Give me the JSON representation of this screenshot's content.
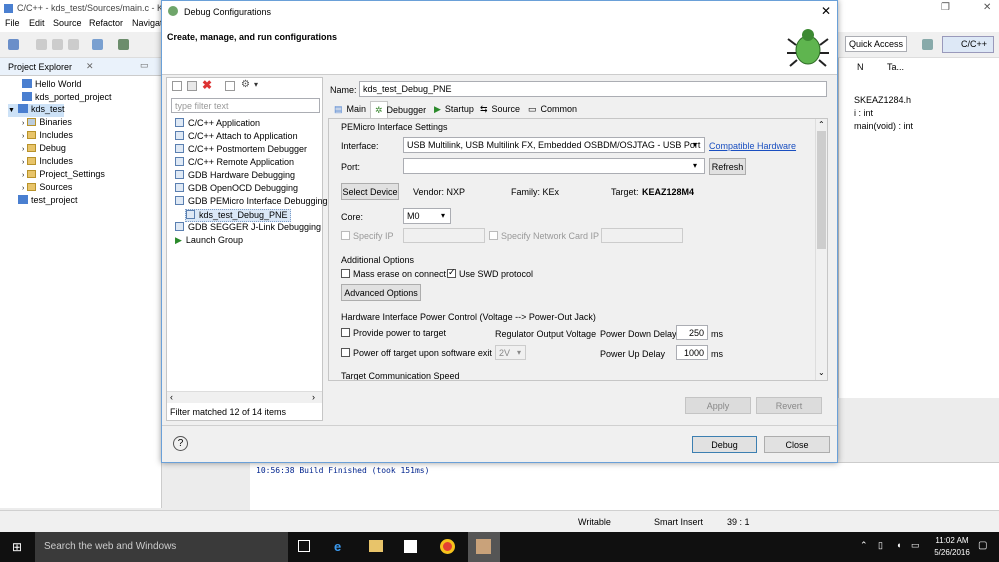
{
  "eclipse": {
    "window_title": "C/C++ - kds_test/Sources/main.c - Ki",
    "menu": [
      "File",
      "Edit",
      "Source",
      "Refactor",
      "Navigat"
    ],
    "quick_access": "Quick Access",
    "perspective": "C/C++"
  },
  "project_explorer": {
    "title": "Project Explorer",
    "items": [
      {
        "label": "Hello World"
      },
      {
        "label": "kds_ported_project"
      },
      {
        "label": "kds_test"
      },
      {
        "label": "Binaries"
      },
      {
        "label": "Includes"
      },
      {
        "label": "Debug"
      },
      {
        "label": "Includes"
      },
      {
        "label": "Project_Settings"
      },
      {
        "label": "Sources"
      },
      {
        "label": "test_project"
      }
    ]
  },
  "outline": {
    "tab1": "N",
    "tab2": "Ta...",
    "items": [
      "SKEAZ1284.h",
      "i : int",
      "main(void) : int"
    ]
  },
  "console": {
    "line": "10:56:38 Build Finished (took 151ms)"
  },
  "status": {
    "writable": "Writable",
    "insert": "Smart Insert",
    "position": "39 : 1"
  },
  "taskbar": {
    "search": "Search the web and Windows",
    "time": "11:02 AM",
    "date": "5/26/2016"
  },
  "dialog": {
    "title": "Debug Configurations",
    "banner": "Create, manage, and run configurations",
    "filter_placeholder": "type filter text",
    "configs": [
      "C/C++ Application",
      "C/C++ Attach to Application",
      "C/C++ Postmortem Debugger",
      "C/C++ Remote Application",
      "GDB Hardware Debugging",
      "GDB OpenOCD Debugging",
      "GDB PEMicro Interface Debugging",
      "kds_test_Debug_PNE",
      "GDB SEGGER J-Link Debugging",
      "Launch Group"
    ],
    "filter_status": "Filter matched 12 of 14 items",
    "name_label": "Name:",
    "name_value": "kds_test_Debug_PNE",
    "tabs": [
      "Main",
      "Debugger",
      "Startup",
      "Source",
      "Common"
    ],
    "pemicro_section": "PEMicro Interface Settings",
    "interface_label": "Interface:",
    "interface_value": "USB Multilink, USB Multilink FX, Embedded OSBDM/OSJTAG - USB Port",
    "compat_link": "Compatible Hardware",
    "port_label": "Port:",
    "port_value": "",
    "refresh": "Refresh",
    "select_device": "Select Device",
    "vendor": "Vendor:  NXP",
    "family": "Family:  KEx",
    "target_label": "Target:",
    "target_value": "KEAZ128M4",
    "core_label": "Core:",
    "core_value": "M0",
    "specify_ip": "Specify IP",
    "specify_nic": "Specify Network Card IP",
    "additional_options": "Additional Options",
    "mass_erase": "Mass erase on connect",
    "use_swd": "Use SWD protocol",
    "advanced_options": "Advanced Options",
    "power_section": "Hardware Interface Power Control (Voltage --> Power-Out Jack)",
    "provide_power": "Provide power to target",
    "regulator": "Regulator Output Voltage",
    "power_down_label": "Power Down Delay",
    "power_down_value": "250",
    "ms1": "ms",
    "power_off": "Power off target upon software exit",
    "voltage": "2V",
    "power_up_label": "Power Up Delay",
    "power_up_value": "1000",
    "ms2": "ms",
    "comm_speed": "Target Communication Speed",
    "apply": "Apply",
    "revert": "Revert",
    "debug": "Debug",
    "close": "Close",
    "help": "?"
  }
}
